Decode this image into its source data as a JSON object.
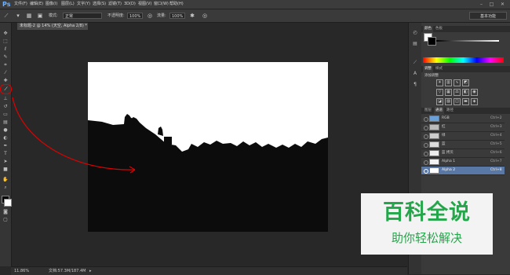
{
  "app": {
    "logo": "Ps"
  },
  "menubar": [
    "文件(F)",
    "编辑(E)",
    "图像(I)",
    "图层(L)",
    "文字(Y)",
    "选择(S)",
    "滤镜(T)",
    "3D(D)",
    "视图(V)",
    "窗口(W)",
    "帮助(H)"
  ],
  "window_controls": {
    "minimize": "–",
    "maximize": "□",
    "close": "✕"
  },
  "options_bar": {
    "mode_label": "模式:",
    "mode_value": "正常",
    "opacity_label": "不透明度:",
    "opacity_value": "100%",
    "flow_label": "流量:",
    "flow_value": "100%",
    "workspace": "基本功能"
  },
  "document_tab": {
    "title": "未标题-2 @ 14% (天空, Alpha 2/8) *",
    "close": "×"
  },
  "status_bar": {
    "zoom": "11.86%",
    "doc_info": "文档:57.3M/187.4M"
  },
  "panels": {
    "color_tabs": [
      "颜色",
      "色板"
    ],
    "adjust_tabs": [
      "调整",
      "样式"
    ],
    "adjust_label": "添加调整",
    "channel_tabs": [
      "图层",
      "通道",
      "路径"
    ]
  },
  "channels": [
    {
      "name": "RGB",
      "shortcut": "Ctrl+2"
    },
    {
      "name": "红",
      "shortcut": "Ctrl+3"
    },
    {
      "name": "绿",
      "shortcut": "Ctrl+4"
    },
    {
      "name": "蓝",
      "shortcut": "Ctrl+5"
    },
    {
      "name": "蓝 拷贝",
      "shortcut": "Ctrl+6"
    },
    {
      "name": "Alpha 1",
      "shortcut": "Ctrl+7"
    },
    {
      "name": "Alpha 2",
      "shortcut": "Ctrl+8",
      "selected": true
    }
  ],
  "watermark": {
    "title": "百科全说",
    "subtitle": "助你轻松解决"
  },
  "colors": {
    "accent_green": "#24a64a",
    "annotation_red": "#e00000",
    "selected_row": "#5a78a6"
  }
}
